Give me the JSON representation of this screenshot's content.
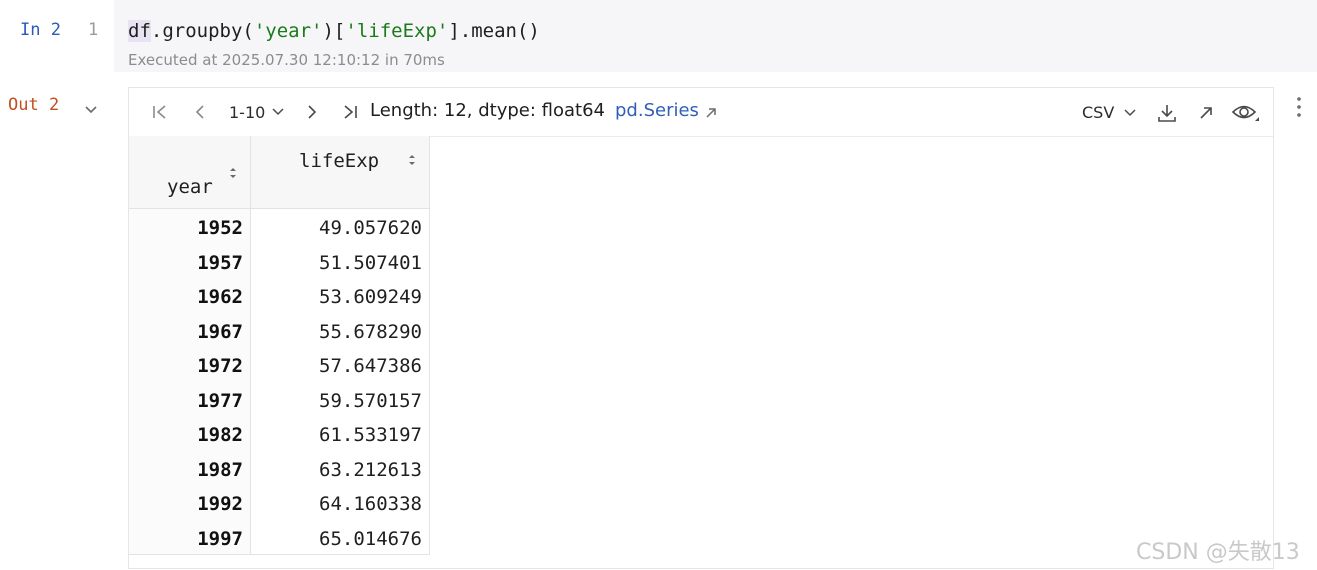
{
  "input_cell": {
    "label": "In 2",
    "line_number": "1",
    "code_tokens": [
      "df",
      ".groupby(",
      "'year'",
      ")[",
      "'lifeExp'",
      "].mean()"
    ],
    "exec_info": "Executed at 2025.07.30 12:10:12 in 70ms"
  },
  "output_cell": {
    "label": "Out 2",
    "toolbar": {
      "range": "1-10",
      "info": "Length: 12, dtype: float64",
      "series_link": "pd.Series",
      "export_format": "CSV"
    },
    "table": {
      "index_header": "year",
      "value_header": "lifeExp",
      "rows": [
        {
          "year": "1952",
          "lifeExp": "49.057620"
        },
        {
          "year": "1957",
          "lifeExp": "51.507401"
        },
        {
          "year": "1962",
          "lifeExp": "53.609249"
        },
        {
          "year": "1967",
          "lifeExp": "55.678290"
        },
        {
          "year": "1972",
          "lifeExp": "57.647386"
        },
        {
          "year": "1977",
          "lifeExp": "59.570157"
        },
        {
          "year": "1982",
          "lifeExp": "61.533197"
        },
        {
          "year": "1987",
          "lifeExp": "63.212613"
        },
        {
          "year": "1992",
          "lifeExp": "64.160338"
        },
        {
          "year": "1997",
          "lifeExp": "65.014676"
        }
      ]
    }
  },
  "icons": {
    "first_page": "first-page-icon",
    "prev_page": "chevron-left-icon",
    "next_page": "chevron-right-icon",
    "last_page": "last-page-icon",
    "download": "download-icon",
    "expand": "expand-arrow-icon",
    "view": "eye-icon",
    "menu": "more-vertical-icon"
  },
  "colors": {
    "in_label": "#2a5bb8",
    "out_label": "#c0501e",
    "string_literal": "#1b7a1b",
    "link": "#2f5fb9"
  },
  "watermark": "CSDN @失散13"
}
